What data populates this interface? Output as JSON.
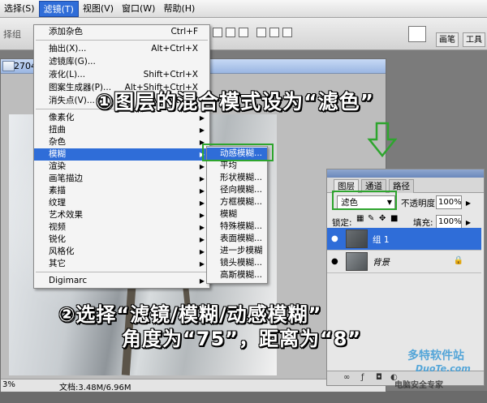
{
  "menubar": {
    "items": [
      {
        "label": "选择(S)"
      },
      {
        "label": "滤镜(T)"
      },
      {
        "label": "视图(V)"
      },
      {
        "label": "窗口(W)"
      },
      {
        "label": "帮助(H)"
      }
    ]
  },
  "optionsbar": {
    "left_label": "择组",
    "tab_brush": "画笔",
    "tab_tool": "工具"
  },
  "document": {
    "title": "342704c",
    "zoom": "3%",
    "doc_info": "文档:3.48M/6.96M"
  },
  "filter_menu": {
    "items": [
      {
        "label": "添加杂色",
        "shortcut": "Ctrl+F"
      },
      {
        "label": "抽出(X)...",
        "shortcut": "Alt+Ctrl+X"
      },
      {
        "label": "滤镜库(G)..."
      },
      {
        "label": "液化(L)...",
        "shortcut": "Shift+Ctrl+X"
      },
      {
        "label": "图案生成器(P)...",
        "shortcut": "Alt+Shift+Ctrl+X"
      },
      {
        "label": "消失点(V)...",
        "shortcut": "Alt+Ctrl+V"
      },
      {
        "label": "像素化"
      },
      {
        "label": "扭曲"
      },
      {
        "label": "杂色"
      },
      {
        "label": "模糊"
      },
      {
        "label": "渲染"
      },
      {
        "label": "画笔描边"
      },
      {
        "label": "素描"
      },
      {
        "label": "纹理"
      },
      {
        "label": "艺术效果"
      },
      {
        "label": "视频"
      },
      {
        "label": "锐化"
      },
      {
        "label": "风格化"
      },
      {
        "label": "其它"
      },
      {
        "label": "Digimarc"
      }
    ]
  },
  "blur_submenu": {
    "items": [
      {
        "label": "动感模糊..."
      },
      {
        "label": "平均"
      },
      {
        "label": "形状模糊..."
      },
      {
        "label": "径向模糊..."
      },
      {
        "label": "方框模糊..."
      },
      {
        "label": "模糊"
      },
      {
        "label": "特殊模糊..."
      },
      {
        "label": "表面模糊..."
      },
      {
        "label": "进一步模糊"
      },
      {
        "label": "镜头模糊..."
      },
      {
        "label": "高斯模糊..."
      }
    ]
  },
  "layers_panel": {
    "tabs": [
      {
        "label": "图层"
      },
      {
        "label": "通道"
      },
      {
        "label": "路径"
      }
    ],
    "blend_mode": "滤色",
    "opacity_label": "不透明度:",
    "opacity_value": "100%",
    "lock_label": "锁定:",
    "fill_label": "填充:",
    "fill_value": "100%",
    "layers": [
      {
        "name": "组 1",
        "selected": true
      },
      {
        "name": "背景",
        "selected": false
      }
    ]
  },
  "annotations": {
    "step1": "①图层的混合模式设为“滤色”",
    "step2_line1": "②选择“滤镜/模糊/动感模糊”",
    "step2_line2": "角度为“75”，距离为“8”"
  },
  "watermark": {
    "brand": "多特软件站",
    "url": "DuoTe.com",
    "tagline": "电脑安全专家"
  },
  "colors": {
    "highlight": "#2f6dd8",
    "annotation_box": "#2ea52e"
  }
}
